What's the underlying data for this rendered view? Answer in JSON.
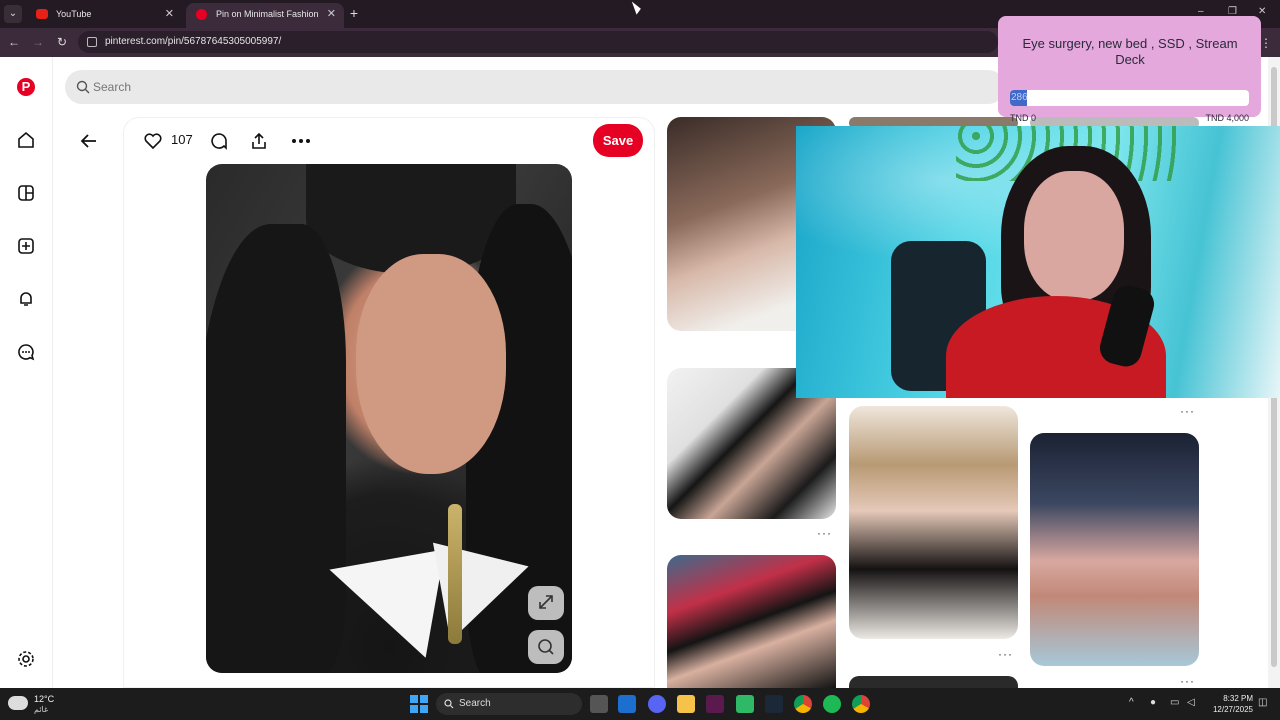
{
  "browser": {
    "tabs": [
      {
        "label": "YouTube",
        "active": false
      },
      {
        "label": "Pin on Minimalist Fashion",
        "active": true
      }
    ],
    "url": "pinterest.com/pin/567876453050059​97/",
    "window_controls": [
      "–",
      "❐",
      "✕"
    ]
  },
  "pinterest": {
    "search_placeholder": "Search",
    "like_count": "107",
    "save_label": "Save",
    "brand_color": "#e60023"
  },
  "donation_goal": {
    "title": "Eye surgery, new bed , SSD , Stream Deck",
    "current": "286",
    "min_label": "TND 0",
    "max_label": "TND 4,000",
    "progress_fraction": 0.0715
  },
  "taskbar": {
    "weather_temp": "12°C",
    "weather_condition": "غائم",
    "search_label": "Search",
    "time": "8:32 PM",
    "date": "12/27/2025"
  }
}
